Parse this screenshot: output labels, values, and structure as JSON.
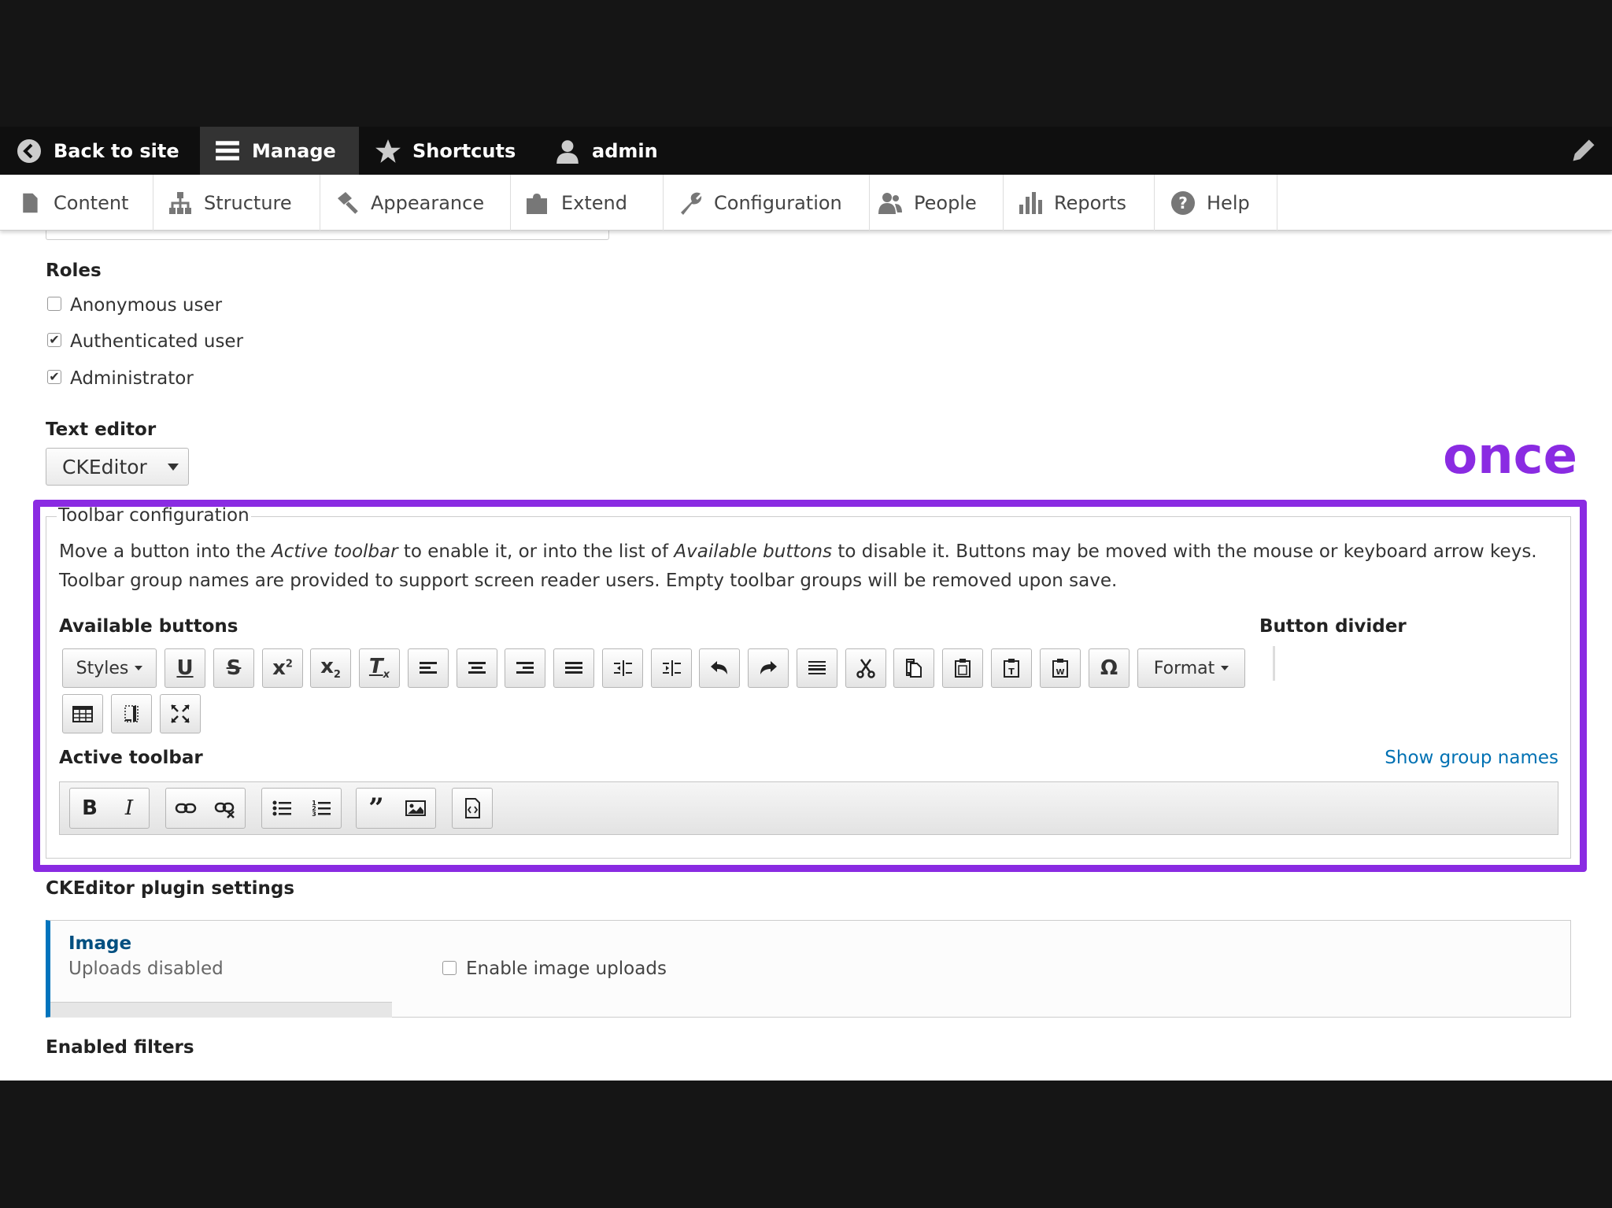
{
  "toolbar": {
    "back_to_site": "Back to site",
    "manage": "Manage",
    "shortcuts": "Shortcuts",
    "user": "admin"
  },
  "tray": {
    "items": [
      {
        "label": "Content",
        "icon": "file-icon"
      },
      {
        "label": "Structure",
        "icon": "sitemap-icon"
      },
      {
        "label": "Appearance",
        "icon": "paintbrush-icon"
      },
      {
        "label": "Extend",
        "icon": "puzzle-icon"
      },
      {
        "label": "Configuration",
        "icon": "wrench-icon"
      },
      {
        "label": "People",
        "icon": "people-icon"
      },
      {
        "label": "Reports",
        "icon": "bar-chart-icon"
      },
      {
        "label": "Help",
        "icon": "help-icon"
      }
    ]
  },
  "form": {
    "roles_label": "Roles",
    "roles": [
      {
        "label": "Anonymous user",
        "checked": false
      },
      {
        "label": "Authenticated user",
        "checked": true
      },
      {
        "label": "Administrator",
        "checked": true
      }
    ],
    "text_editor_label": "Text editor",
    "text_editor_value": "CKEditor"
  },
  "annotation": {
    "text": "once",
    "color": "#8a2be2"
  },
  "toolbar_config": {
    "legend": "Toolbar configuration",
    "desc_1": "Move a button into the ",
    "desc_em1": "Active toolbar",
    "desc_2": " to enable it, or into the list of ",
    "desc_em2": "Available buttons",
    "desc_3": " to disable it. Buttons may be moved with the mouse or keyboard arrow keys. Toolbar group names are provided to support screen reader users. Empty toolbar groups will be removed upon save.",
    "available_label": "Available buttons",
    "divider_label": "Button divider",
    "styles_button": "Styles",
    "format_button": "Format",
    "active_label": "Active toolbar",
    "show_group_names": "Show group names"
  },
  "plugin_settings": {
    "heading": "CKEditor plugin settings",
    "tab_title": "Image",
    "tab_summary": "Uploads disabled",
    "enable_uploads_label": "Enable image uploads",
    "enable_uploads_checked": false
  },
  "enabled_filters_label": "Enabled filters",
  "colors": {
    "accent": "#8a2be2",
    "link": "#0071b3",
    "toolbar_bg": "#0f0f0f"
  }
}
